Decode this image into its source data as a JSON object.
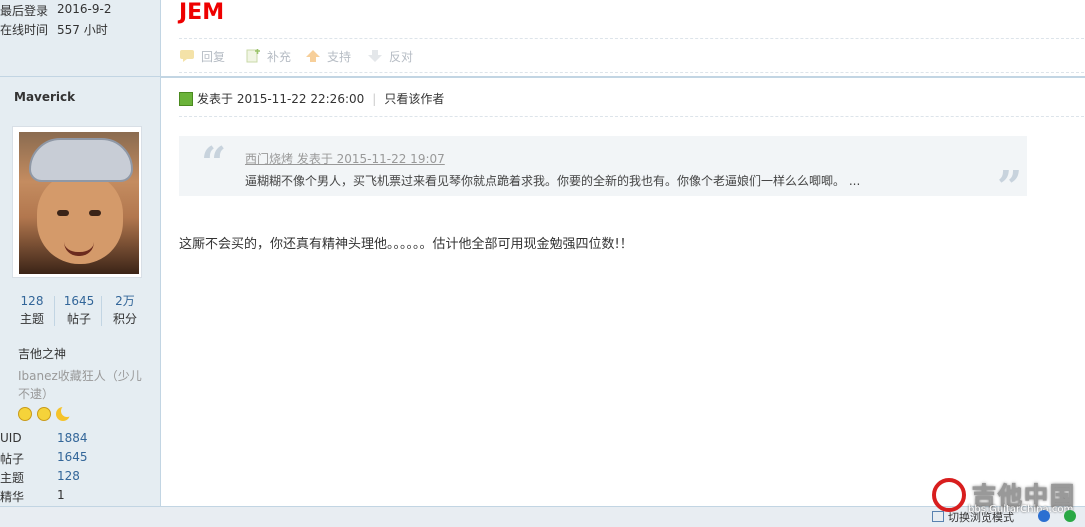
{
  "profile": {
    "last_login_label": "最后登录",
    "last_login_value": "2016-9-2",
    "online_label": "在线时间",
    "online_value": "557 小时",
    "username": "Maverick",
    "stats": [
      {
        "num": "128",
        "label": "主题"
      },
      {
        "num": "1645",
        "label": "帖子"
      },
      {
        "num": "2万",
        "label": "积分"
      }
    ],
    "rank": "吉他之神",
    "custom_title": "Ibanez收藏狂人（少儿不逮）",
    "info": [
      {
        "label": "UID",
        "value": "1884"
      },
      {
        "label": "帖子",
        "value": "1645"
      },
      {
        "label": "主题",
        "value": "128"
      },
      {
        "label": "精华",
        "value": "1"
      }
    ]
  },
  "post_top": {
    "title": "JEM",
    "actions": [
      {
        "label": "回复",
        "icon": "reply-icon"
      },
      {
        "label": "补充",
        "icon": "supplement-icon"
      },
      {
        "label": "支持",
        "icon": "thumb-up-icon"
      },
      {
        "label": "反对",
        "icon": "thumb-down-icon"
      }
    ]
  },
  "post": {
    "posted_at": "发表于 2015-11-22 22:26:00",
    "author_only": "只看该作者",
    "quote_source": "西门烧烤 发表于 2015-11-22 19:07",
    "quote_text": "逼糊糊不像个男人，买飞机票过来看见琴你就点跪着求我。你要的全新的我也有。你像个老逼娘们一样么么唧唧。 ...",
    "content": "这厮不会买的，你还真有精神头理他。。。。。。估计他全部可用现金勉强四位数!！"
  },
  "footer": {
    "switch_label": "切换浏览模式",
    "logo_text": "吉他中国",
    "logo_url": "bbs.GuitarChina.com"
  },
  "colors": {
    "sidebar_bg": "#e5edf2",
    "title_red": "#e00000",
    "link_blue": "#336699"
  }
}
